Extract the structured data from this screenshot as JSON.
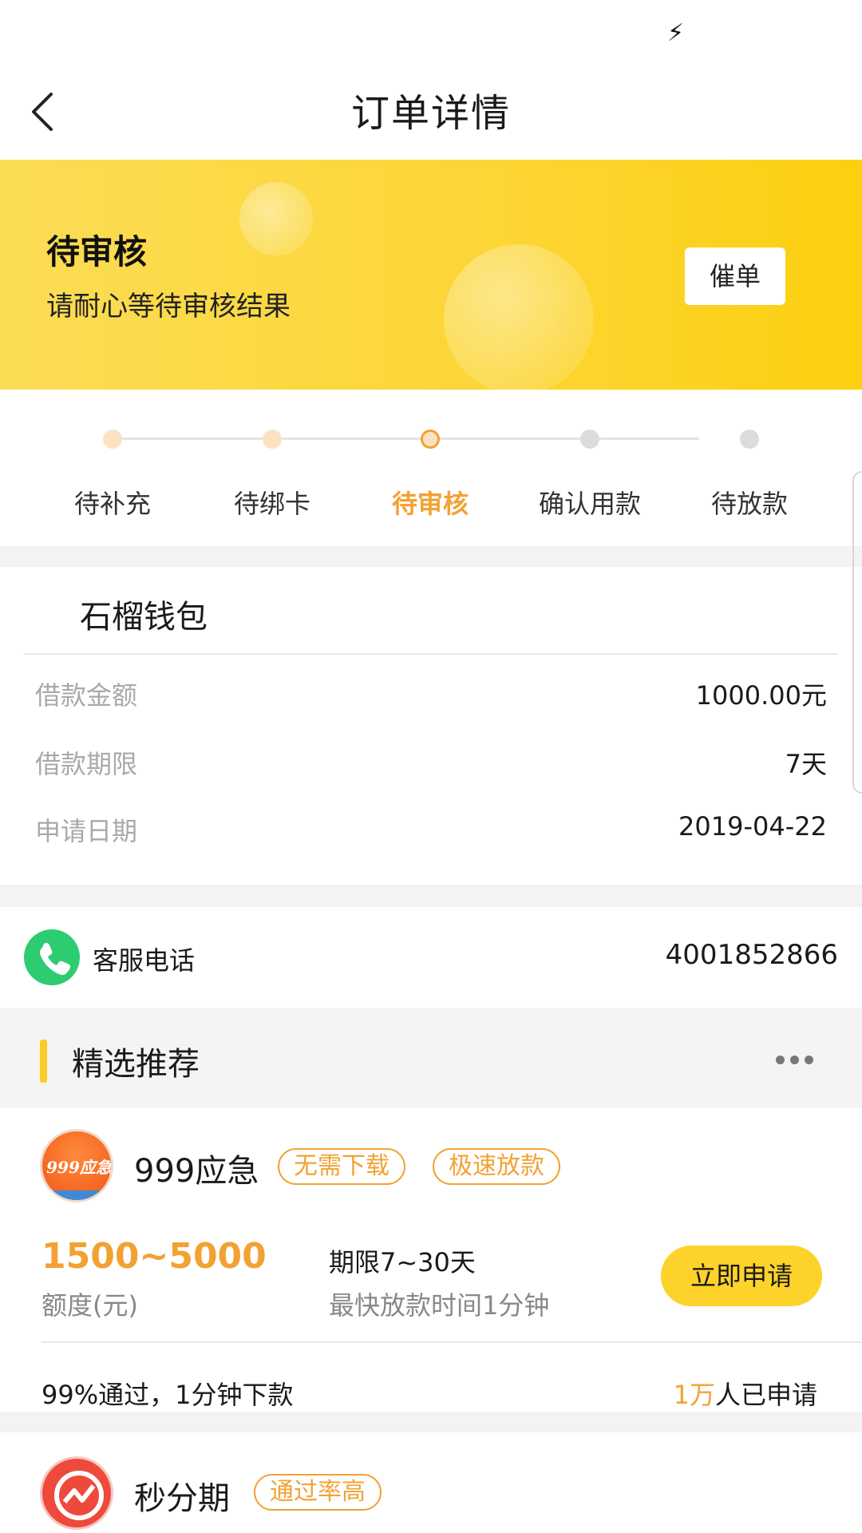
{
  "nav": {
    "title": "订单详情"
  },
  "banner": {
    "status": "待审核",
    "message": "请耐心等待审核结果",
    "urge_label": "催单"
  },
  "steps": [
    {
      "label": "待补充",
      "state": "done"
    },
    {
      "label": "待绑卡",
      "state": "done"
    },
    {
      "label": "待审核",
      "state": "current"
    },
    {
      "label": "确认用款",
      "state": "pending"
    },
    {
      "label": "待放款",
      "state": "pending"
    }
  ],
  "order": {
    "merchant": "石榴钱包",
    "rows": [
      {
        "label": "借款金额",
        "value": "1000.00元"
      },
      {
        "label": "借款期限",
        "value": "7天"
      },
      {
        "label": "申请日期",
        "value": "2019-04-22"
      }
    ]
  },
  "hotline": {
    "label": "客服电话",
    "number": "4001852866"
  },
  "recommend": {
    "title": "精选推荐",
    "products": [
      {
        "name": "999应急",
        "logo_text": "999应急",
        "tags": [
          "无需下载",
          "极速放款"
        ],
        "amount": "1500~5000",
        "amount_label": "额度(元)",
        "term": "期限7~30天",
        "speed": "最快放款时间1分钟",
        "apply_label": "立即申请",
        "pass_text": "99%通过，1分钟下款",
        "applied_count": "1万",
        "applied_suffix": "人已申请"
      },
      {
        "name": "秒分期",
        "tags": [
          "通过率高"
        ]
      }
    ]
  },
  "colors": {
    "accent": "#f2a233",
    "banner": "#fcd637",
    "button": "#fdd22b",
    "phone": "#2ecc71"
  }
}
